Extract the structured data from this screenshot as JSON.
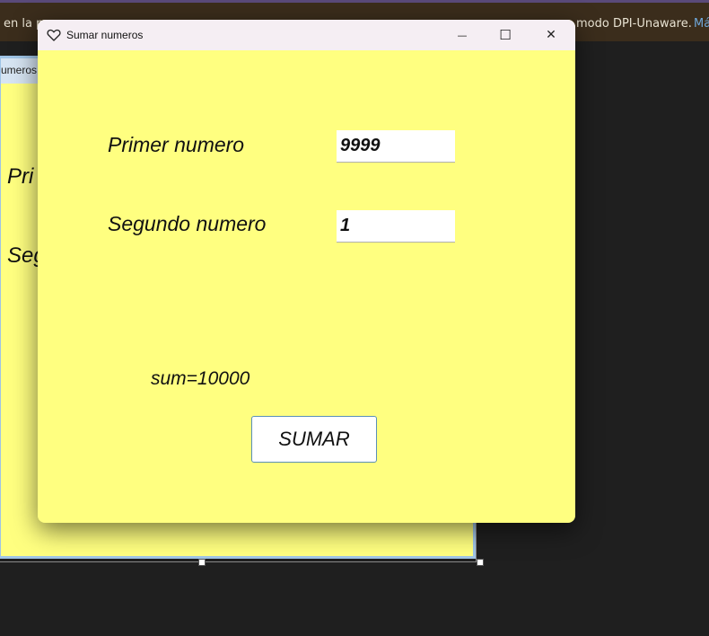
{
  "ide": {
    "banner_left": "en la p",
    "banner_right": "modo DPI-Unaware.",
    "banner_link": "Má",
    "designer_tab": "umeros",
    "designer_label_1": "Pri",
    "designer_label_2": "Seg"
  },
  "window": {
    "title": "Sumar numeros",
    "icon": "heart-icon",
    "minimize_glyph": "—",
    "maximize_glyph": "☐",
    "close_glyph": "✕"
  },
  "form": {
    "first_label": "Primer numero",
    "first_value": "9999",
    "second_label": "Segundo numero",
    "second_value": "1",
    "result_text": "sum=10000",
    "sum_button": "SUMAR"
  },
  "colors": {
    "form_background": "#ffff80",
    "titlebar": "#f5eef3"
  }
}
